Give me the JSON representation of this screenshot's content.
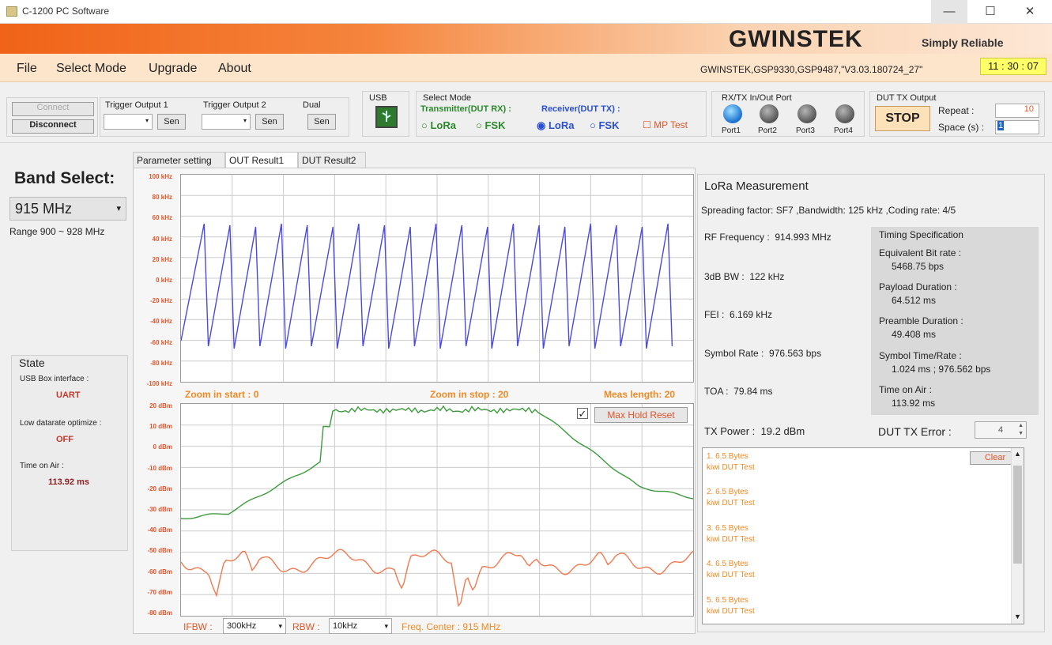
{
  "window": {
    "title": "C-1200 PC Software",
    "minimize": "—",
    "maximize": "☐",
    "close": "✕"
  },
  "brand": {
    "logo": "GWINSTEK",
    "slogan": "Simply  Reliable",
    "colors": {
      "accent": "#f06318"
    }
  },
  "menu": {
    "items": [
      "File",
      "Select Mode",
      "Upgrade",
      "About"
    ]
  },
  "device_id": "GWINSTEK,GSP9330,GSP9487,\"V3.03.180724_27\"",
  "clock": "11 : 30 : 07",
  "toolbar": {
    "connect": "Connect",
    "disconnect": "Disconnect",
    "trigger1": {
      "label": "Trigger Output 1",
      "send": "Sen"
    },
    "trigger2": {
      "label": "Trigger Output 2",
      "send": "Sen"
    },
    "dual": {
      "label": "Dual",
      "send": "Sen"
    },
    "usb_label": "USB",
    "select_mode": {
      "title": "Select Mode",
      "transmitter": "Transmitter(DUT RX) :",
      "receiver": "Receiver(DUT TX) :",
      "lora": "LoRa",
      "fsk": "FSK",
      "mp_test": "MP Test"
    },
    "rxtx_port": {
      "title": "RX/TX In/Out Port",
      "ports": [
        "Port1",
        "Port2",
        "Port3",
        "Port4"
      ]
    },
    "dut_tx_output": {
      "title": "DUT TX Output",
      "stop": "STOP",
      "repeat_label": "Repeat :",
      "repeat_value": "10",
      "space_label": "Space (s) :",
      "space_value": "1"
    }
  },
  "band": {
    "title": "Band Select:",
    "value": "915 MHz",
    "range": "Range 900 ~ 928 MHz"
  },
  "state": {
    "title": "State",
    "usb_label": "USB Box interface :",
    "usb_value": "UART",
    "ldro_label": "Low datarate optimize :",
    "ldro_value": "OFF",
    "toa_label": "Time on Air :",
    "toa_value": "113.92 ms"
  },
  "tabs": [
    "Parameter setting",
    "OUT Result1",
    "DUT Result2"
  ],
  "freq_plot": {
    "y_ticks": [
      "100 kHz",
      "80 kHz",
      "60 kHz",
      "40 kHz",
      "20 kHz",
      "0 kHz",
      "-20 kHz",
      "-40 kHz",
      "-60 kHz",
      "-80 kHz",
      "-100 kHz"
    ],
    "zoom_start_label": "Zoom in start :",
    "zoom_start": "0",
    "zoom_stop_label": "Zoom in stop :",
    "zoom_stop": "20",
    "meas_len_label": "Meas length:",
    "meas_len": "20"
  },
  "power_plot": {
    "y_ticks": [
      "20 dBm",
      "10 dBm",
      "0 dBm",
      "-10 dBm",
      "-20 dBm",
      "-30 dBm",
      "-40 dBm",
      "-50 dBm",
      "-60 dBm",
      "-70 dBm",
      "-80 dBm"
    ],
    "max_hold_reset": "Max Hold Reset",
    "ifbw_label": "IFBW :",
    "ifbw_value": "300kHz",
    "rbw_label": "RBW :",
    "rbw_value": "10kHz",
    "freq_center_label": "Freq. Center :",
    "freq_center": "915 MHz"
  },
  "lora": {
    "title": "LoRa Measurement",
    "params": "Spreading factor: SF7 ,Bandwidth: 125 kHz ,Coding rate: 4/5",
    "rf_freq_label": "RF Frequency :",
    "rf_freq": "914.993 MHz",
    "bw_label": "3dB BW :",
    "bw": "122 kHz",
    "fei_label": "FEI :",
    "fei": "6.169 kHz",
    "symrate_label": "Symbol Rate :",
    "symrate": "976.563 bps",
    "toa_label": "TOA :",
    "toa": "79.84 ms",
    "txpower_label": "TX Power :",
    "txpower": "19.2 dBm",
    "dut_err_label": "DUT TX Error :",
    "dut_err": "4",
    "timing": {
      "title": "Timing Specification",
      "items": [
        {
          "label": "Equivalent Bit rate :",
          "value": "5468.75 bps"
        },
        {
          "label": "Payload Duration :",
          "value": "64.512 ms"
        },
        {
          "label": "Preamble Duration :",
          "value": "49.408 ms"
        },
        {
          "label": "Symbol Time/Rate :",
          "value": "1.024 ms ; 976.562 bps"
        },
        {
          "label": "Time on Air :",
          "value": "113.92 ms"
        }
      ]
    },
    "clear": "Clear",
    "log": [
      {
        "line1": "1. 6.5 Bytes",
        "line2": "kiwi DUT Test"
      },
      {
        "line1": "2. 6.5 Bytes",
        "line2": "kiwi DUT Test"
      },
      {
        "line1": "3. 6.5 Bytes",
        "line2": "kiwi DUT Test"
      },
      {
        "line1": "4. 6.5 Bytes",
        "line2": "kiwi DUT Test"
      },
      {
        "line1": "5. 6.5 Bytes",
        "line2": "kiwi DUT Test"
      }
    ]
  }
}
